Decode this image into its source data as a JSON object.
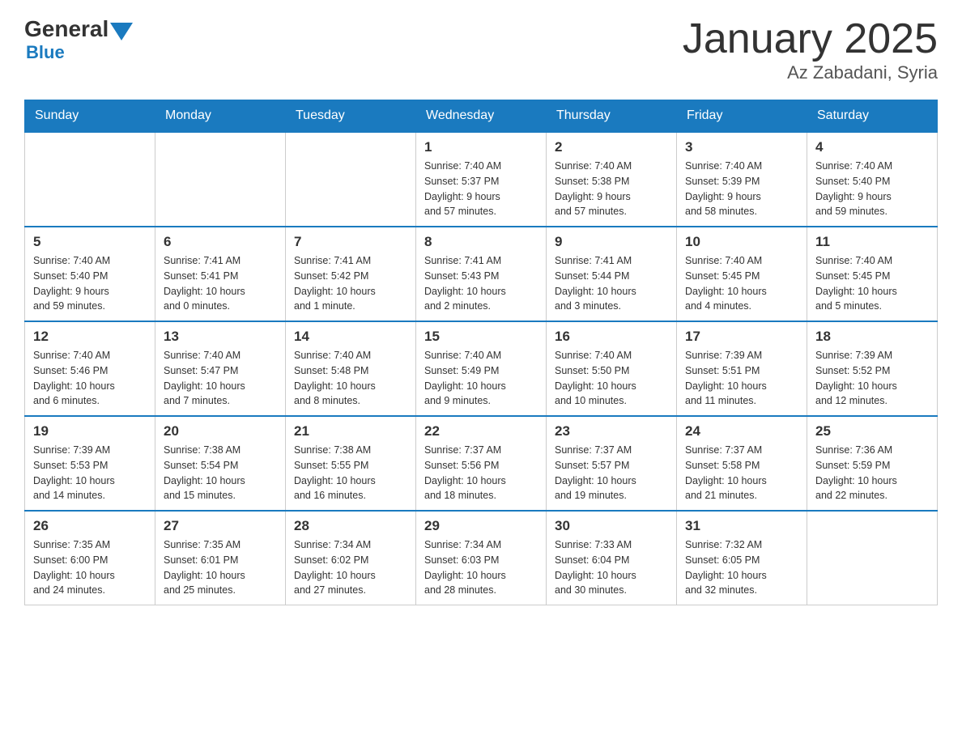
{
  "header": {
    "title": "January 2025",
    "location": "Az Zabadani, Syria",
    "logo_general": "General",
    "logo_blue": "Blue"
  },
  "days_of_week": [
    "Sunday",
    "Monday",
    "Tuesday",
    "Wednesday",
    "Thursday",
    "Friday",
    "Saturday"
  ],
  "weeks": [
    [
      {
        "day": "",
        "info": ""
      },
      {
        "day": "",
        "info": ""
      },
      {
        "day": "",
        "info": ""
      },
      {
        "day": "1",
        "info": "Sunrise: 7:40 AM\nSunset: 5:37 PM\nDaylight: 9 hours\nand 57 minutes."
      },
      {
        "day": "2",
        "info": "Sunrise: 7:40 AM\nSunset: 5:38 PM\nDaylight: 9 hours\nand 57 minutes."
      },
      {
        "day": "3",
        "info": "Sunrise: 7:40 AM\nSunset: 5:39 PM\nDaylight: 9 hours\nand 58 minutes."
      },
      {
        "day": "4",
        "info": "Sunrise: 7:40 AM\nSunset: 5:40 PM\nDaylight: 9 hours\nand 59 minutes."
      }
    ],
    [
      {
        "day": "5",
        "info": "Sunrise: 7:40 AM\nSunset: 5:40 PM\nDaylight: 9 hours\nand 59 minutes."
      },
      {
        "day": "6",
        "info": "Sunrise: 7:41 AM\nSunset: 5:41 PM\nDaylight: 10 hours\nand 0 minutes."
      },
      {
        "day": "7",
        "info": "Sunrise: 7:41 AM\nSunset: 5:42 PM\nDaylight: 10 hours\nand 1 minute."
      },
      {
        "day": "8",
        "info": "Sunrise: 7:41 AM\nSunset: 5:43 PM\nDaylight: 10 hours\nand 2 minutes."
      },
      {
        "day": "9",
        "info": "Sunrise: 7:41 AM\nSunset: 5:44 PM\nDaylight: 10 hours\nand 3 minutes."
      },
      {
        "day": "10",
        "info": "Sunrise: 7:40 AM\nSunset: 5:45 PM\nDaylight: 10 hours\nand 4 minutes."
      },
      {
        "day": "11",
        "info": "Sunrise: 7:40 AM\nSunset: 5:45 PM\nDaylight: 10 hours\nand 5 minutes."
      }
    ],
    [
      {
        "day": "12",
        "info": "Sunrise: 7:40 AM\nSunset: 5:46 PM\nDaylight: 10 hours\nand 6 minutes."
      },
      {
        "day": "13",
        "info": "Sunrise: 7:40 AM\nSunset: 5:47 PM\nDaylight: 10 hours\nand 7 minutes."
      },
      {
        "day": "14",
        "info": "Sunrise: 7:40 AM\nSunset: 5:48 PM\nDaylight: 10 hours\nand 8 minutes."
      },
      {
        "day": "15",
        "info": "Sunrise: 7:40 AM\nSunset: 5:49 PM\nDaylight: 10 hours\nand 9 minutes."
      },
      {
        "day": "16",
        "info": "Sunrise: 7:40 AM\nSunset: 5:50 PM\nDaylight: 10 hours\nand 10 minutes."
      },
      {
        "day": "17",
        "info": "Sunrise: 7:39 AM\nSunset: 5:51 PM\nDaylight: 10 hours\nand 11 minutes."
      },
      {
        "day": "18",
        "info": "Sunrise: 7:39 AM\nSunset: 5:52 PM\nDaylight: 10 hours\nand 12 minutes."
      }
    ],
    [
      {
        "day": "19",
        "info": "Sunrise: 7:39 AM\nSunset: 5:53 PM\nDaylight: 10 hours\nand 14 minutes."
      },
      {
        "day": "20",
        "info": "Sunrise: 7:38 AM\nSunset: 5:54 PM\nDaylight: 10 hours\nand 15 minutes."
      },
      {
        "day": "21",
        "info": "Sunrise: 7:38 AM\nSunset: 5:55 PM\nDaylight: 10 hours\nand 16 minutes."
      },
      {
        "day": "22",
        "info": "Sunrise: 7:37 AM\nSunset: 5:56 PM\nDaylight: 10 hours\nand 18 minutes."
      },
      {
        "day": "23",
        "info": "Sunrise: 7:37 AM\nSunset: 5:57 PM\nDaylight: 10 hours\nand 19 minutes."
      },
      {
        "day": "24",
        "info": "Sunrise: 7:37 AM\nSunset: 5:58 PM\nDaylight: 10 hours\nand 21 minutes."
      },
      {
        "day": "25",
        "info": "Sunrise: 7:36 AM\nSunset: 5:59 PM\nDaylight: 10 hours\nand 22 minutes."
      }
    ],
    [
      {
        "day": "26",
        "info": "Sunrise: 7:35 AM\nSunset: 6:00 PM\nDaylight: 10 hours\nand 24 minutes."
      },
      {
        "day": "27",
        "info": "Sunrise: 7:35 AM\nSunset: 6:01 PM\nDaylight: 10 hours\nand 25 minutes."
      },
      {
        "day": "28",
        "info": "Sunrise: 7:34 AM\nSunset: 6:02 PM\nDaylight: 10 hours\nand 27 minutes."
      },
      {
        "day": "29",
        "info": "Sunrise: 7:34 AM\nSunset: 6:03 PM\nDaylight: 10 hours\nand 28 minutes."
      },
      {
        "day": "30",
        "info": "Sunrise: 7:33 AM\nSunset: 6:04 PM\nDaylight: 10 hours\nand 30 minutes."
      },
      {
        "day": "31",
        "info": "Sunrise: 7:32 AM\nSunset: 6:05 PM\nDaylight: 10 hours\nand 32 minutes."
      },
      {
        "day": "",
        "info": ""
      }
    ]
  ]
}
